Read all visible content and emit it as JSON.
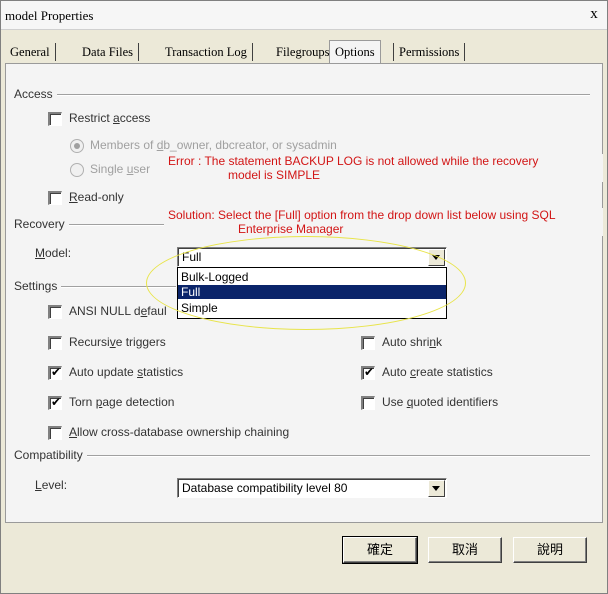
{
  "window": {
    "title": "model Properties",
    "close": "x"
  },
  "tabs": [
    "General",
    "Data Files",
    "Transaction Log",
    "Filegroups",
    "Options",
    "Permissions"
  ],
  "access": {
    "header": "Access",
    "restrict_access": {
      "pre": "Restrict ",
      "key": "a",
      "post": "ccess",
      "checked": false
    },
    "members_option": {
      "pre": "Members of ",
      "key": "d",
      "post": "b_owner, dbcreator, or sysadmin",
      "selected": true,
      "enabled": false
    },
    "single_user": {
      "pre": "Single ",
      "key": "u",
      "post": "ser",
      "selected": false,
      "enabled": false
    },
    "read_only": {
      "pre": "",
      "key": "R",
      "post": "ead-only",
      "checked": false
    }
  },
  "error_note": {
    "line1": "Error : The statement BACKUP LOG is not allowed while the recovery",
    "line2": "model is SIMPLE",
    "line3": "Solution: Select the [Full] option from the drop down list below using SQL",
    "line4": "Enterprise Manager"
  },
  "recovery": {
    "header": "Recovery",
    "model_label_key": "M",
    "model_label_rest": "odel:",
    "model_value": "Full",
    "options": [
      "Bulk-Logged",
      "Full",
      "Simple"
    ],
    "highlighted_option": "Full"
  },
  "settings": {
    "header": "Settings",
    "ansi_null": {
      "pre": "ANSI NULL d",
      "key": "e",
      "post": "faul",
      "checked": false
    },
    "recursive_triggers": {
      "pre": "Recursi",
      "key": "v",
      "post": "e triggers",
      "checked": false
    },
    "auto_update_stats": {
      "pre": "Auto update ",
      "key": "s",
      "post": "tatistics",
      "checked": true
    },
    "torn_page": {
      "pre": "Torn ",
      "key": "p",
      "post": "age detection",
      "checked": true
    },
    "cross_db": {
      "pre": "",
      "key": "A",
      "post": "llow cross-database ownership chaining",
      "checked": false
    },
    "auto_shrink": {
      "pre": "Auto shri",
      "key": "n",
      "post": "k",
      "checked": false
    },
    "auto_create_stats": {
      "pre": "Auto ",
      "key": "c",
      "post": "reate statistics",
      "checked": true
    },
    "quoted_identifiers": {
      "pre": "Use ",
      "key": "q",
      "post": "uoted identifiers",
      "checked": false
    }
  },
  "compatibility": {
    "header": "Compatibility",
    "level_label_key": "L",
    "level_label_rest": "evel:",
    "level_value": "Database compatibility level 80"
  },
  "buttons": {
    "ok": "確定",
    "cancel": "取消",
    "help": "說明"
  },
  "colors": {
    "error_text": "#d21515",
    "highlight": "#0a246a",
    "annotation_ellipse": "#e8e44a"
  }
}
